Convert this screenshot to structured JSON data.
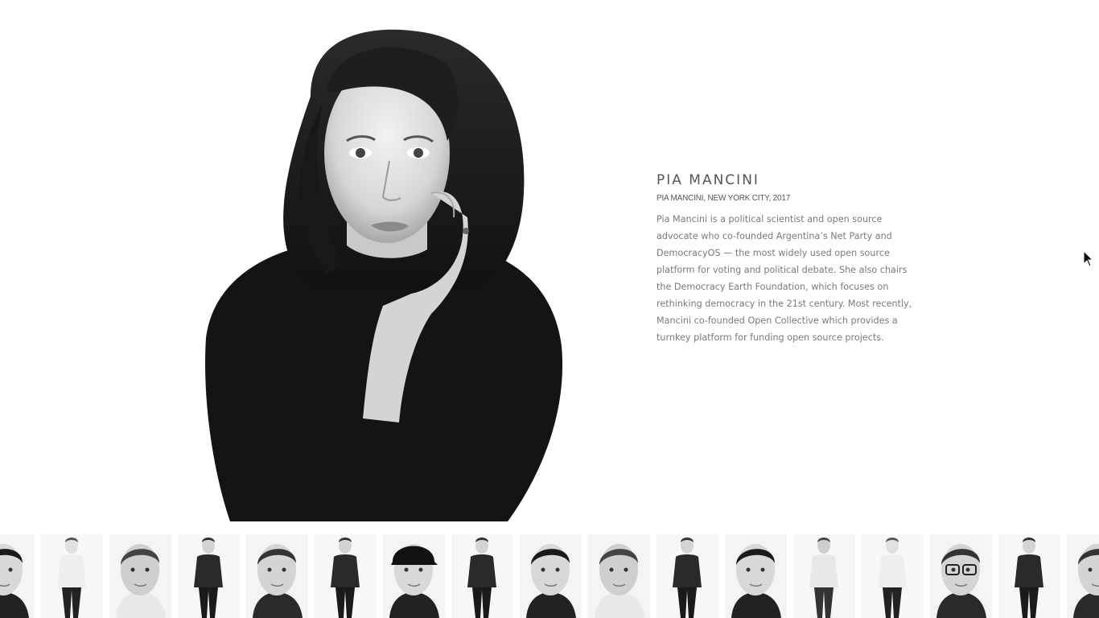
{
  "profile": {
    "name": "PIA MANCINI",
    "caption": "PIA MANCINI, NEW YORK CITY, 2017",
    "bio": "Pia Mancini is a political scientist and open source advocate who co-founded Argentina’s Net Party and DemocracyOS — the most widely used open source platform for voting and political debate. She also chairs the Democracy Earth Foundation, which focuses on rethinking democracy in the 21st century. Most recently, Mancini co-founded Open Collective which provides a turnkey platform for funding open source projects."
  },
  "thumbnails": [
    {
      "kind": "portrait-woman-dark-hair"
    },
    {
      "kind": "full-body-karate-uniform"
    },
    {
      "kind": "closeup-man"
    },
    {
      "kind": "full-body-woman-arms-crossed"
    },
    {
      "kind": "man-plaid-shirt-leaning"
    },
    {
      "kind": "full-body-man-sweater"
    },
    {
      "kind": "closeup-man-ny-cap"
    },
    {
      "kind": "full-body-woman-black"
    },
    {
      "kind": "portrait-woman-hand-chin"
    },
    {
      "kind": "closeup-older-man"
    },
    {
      "kind": "full-body-man-arms-crossed"
    },
    {
      "kind": "portrait-woman-smiling"
    },
    {
      "kind": "man-seated-shirt"
    },
    {
      "kind": "full-body-woman-blazer"
    },
    {
      "kind": "closeup-man-glasses"
    },
    {
      "kind": "person-on-chair"
    },
    {
      "kind": "closeup-man-partial"
    }
  ],
  "colors": {
    "heading": "#555555",
    "body_text": "#7a7a7a",
    "background": "#ffffff"
  }
}
